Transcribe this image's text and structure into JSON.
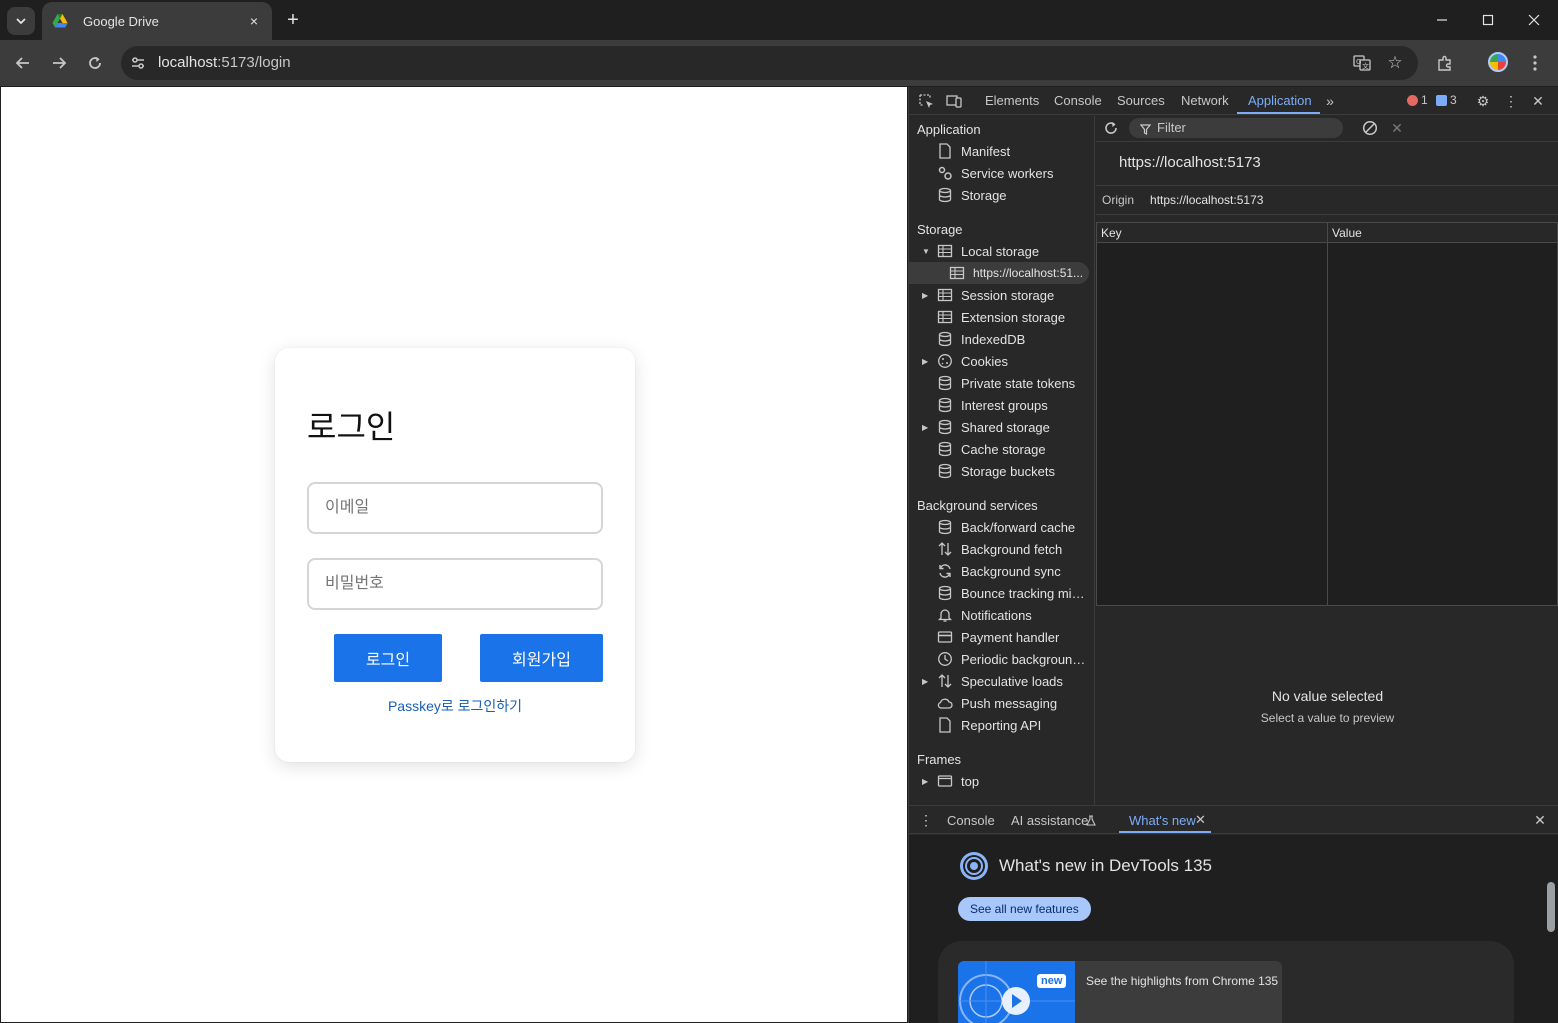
{
  "browser": {
    "tab_title": "Google Drive",
    "url_host": "localhost",
    "url_rest": ":5173/login",
    "tab_close": "×",
    "new_tab": "+"
  },
  "login": {
    "title": "로그인",
    "email_placeholder": "이메일",
    "password_placeholder": "비밀번호",
    "login_button": "로그인",
    "signup_button": "회원가입",
    "passkey_link": "Passkey로 로그인하기",
    "accent_color": "#1a73e8"
  },
  "devtools": {
    "tabs": [
      "Elements",
      "Console",
      "Sources",
      "Network",
      "Application"
    ],
    "active_tab": "Application",
    "error_count": "1",
    "message_count": "3",
    "sidebar": {
      "application_header": "Application",
      "application_items": [
        "Manifest",
        "Service workers",
        "Storage"
      ],
      "storage_header": "Storage",
      "storage_items": {
        "local_storage": "Local storage",
        "local_storage_origin": "https://localhost:51...",
        "session_storage": "Session storage",
        "extension_storage": "Extension storage",
        "indexeddb": "IndexedDB",
        "cookies": "Cookies",
        "private_state_tokens": "Private state tokens",
        "interest_groups": "Interest groups",
        "shared_storage": "Shared storage",
        "cache_storage": "Cache storage",
        "storage_buckets": "Storage buckets"
      },
      "background_header": "Background services",
      "background_items": {
        "back_forward_cache": "Back/forward cache",
        "background_fetch": "Background fetch",
        "background_sync": "Background sync",
        "bounce_tracking": "Bounce tracking miti...",
        "notifications": "Notifications",
        "payment_handler": "Payment handler",
        "periodic_background": "Periodic background ...",
        "speculative_loads": "Speculative loads",
        "push_messaging": "Push messaging",
        "reporting_api": "Reporting API"
      },
      "frames_header": "Frames",
      "frames_top": "top"
    },
    "main": {
      "filter_placeholder": "Filter",
      "origin_heading": "https://localhost:5173",
      "origin_label": "Origin",
      "origin_value": "https://localhost:5173",
      "col_key": "Key",
      "col_value": "Value",
      "no_value": "No value selected",
      "no_value_sub": "Select a value to preview"
    },
    "drawer": {
      "tabs": [
        "Console",
        "AI assistance",
        "What's new"
      ],
      "active_tab": "What's new",
      "whats_new_title": "What's new in DevTools 135",
      "see_all_button": "See all new features",
      "new_badge": "new",
      "highlights_text": "See the highlights from Chrome 135"
    }
  }
}
